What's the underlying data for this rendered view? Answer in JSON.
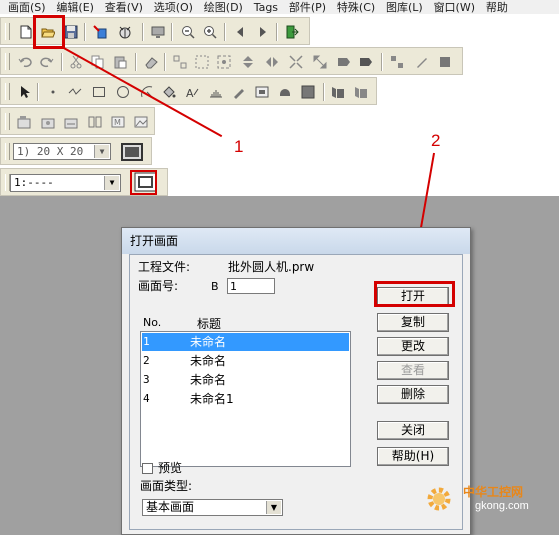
{
  "menu": [
    "画面(S)",
    "编辑(E)",
    "查看(V)",
    "选项(O)",
    "绘图(D)",
    "Tags",
    "部件(P)",
    "特殊(C)",
    "图库(L)",
    "窗口(W)",
    "帮助"
  ],
  "toolbar": {
    "grid_combo_value": "1) 20 X 20",
    "page_combo_value": "1:----"
  },
  "callouts": [
    "1",
    "2"
  ],
  "dialog": {
    "title": "打开画面",
    "project_label": "工程文件:",
    "project_value": "批外圆人机.prw",
    "screen_no_label": "画面号:",
    "screen_no_prefix": "B",
    "screen_no_value": "1",
    "list_header_no": "No.",
    "list_header_title": "标题",
    "rows": [
      {
        "no": "1",
        "title": "未命名"
      },
      {
        "no": "2",
        "title": "未命名"
      },
      {
        "no": "3",
        "title": "未命名"
      },
      {
        "no": "4",
        "title": "未命名1"
      }
    ],
    "preview_label": "预览",
    "type_label": "画面类型:",
    "type_value": "基本画面",
    "buttons": {
      "open": "打开",
      "copy": "复制",
      "change": "更改",
      "view": "查看",
      "delete": "删除",
      "close": "关闭",
      "help": "帮助(H)"
    }
  },
  "watermark": {
    "brand": "中华工控网",
    "domain": "gkong.com"
  },
  "colors": {
    "accent_red": "#d40000",
    "selection_blue": "#3399ff",
    "workspace_gray": "#a0a0a0"
  }
}
